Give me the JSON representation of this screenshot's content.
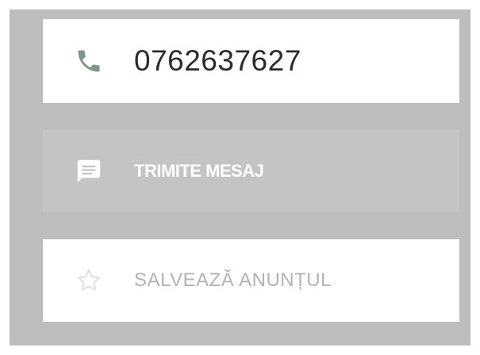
{
  "contact": {
    "phone": {
      "icon": "phone-icon",
      "number": "0762637627",
      "icon_color": "#7a9a86"
    },
    "message_button": {
      "icon": "chat-icon",
      "label": "TRIMITE MESAJ",
      "background": "#c4c4c4",
      "text_color": "#ffffff"
    },
    "save_button": {
      "icon": "star-icon",
      "label": "SALVEAZĂ ANUNȚUL",
      "text_color": "#b3b3b3"
    }
  }
}
